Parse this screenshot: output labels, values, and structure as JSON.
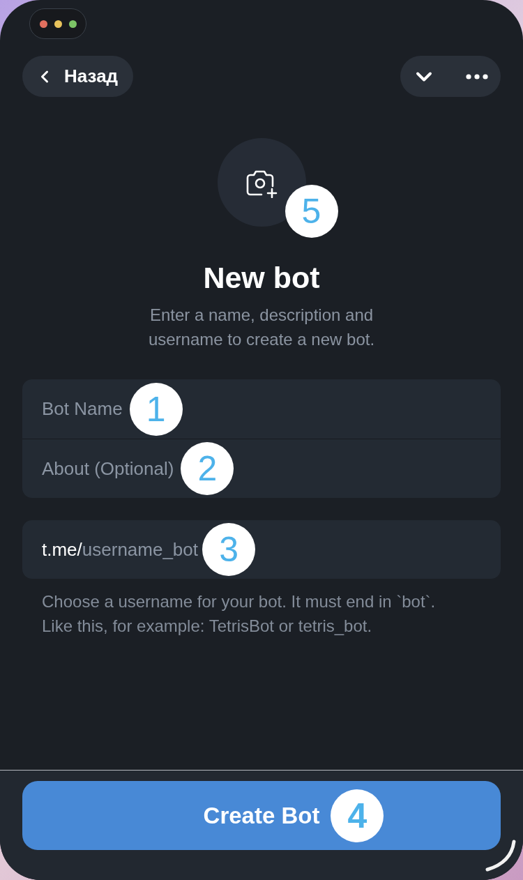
{
  "window_controls": [
    {
      "color": "#e2705f"
    },
    {
      "color": "#e8c35c"
    },
    {
      "color": "#7cc466"
    }
  ],
  "header": {
    "back_button": {
      "label": "Назад"
    }
  },
  "photo": {
    "marker": "5"
  },
  "title": "New bot",
  "subtitle": "Enter a name, description and username to create a new bot.",
  "fields": [
    {
      "placeholder": "Bot Name",
      "marker": "1"
    },
    {
      "placeholder": "About (Optional)",
      "marker": "2"
    }
  ],
  "username_field": {
    "prefix": "t.me/",
    "placeholder": "username_bot",
    "marker": "3"
  },
  "hint": "Choose a username for your bot. It must end in `bot`. Like this, for example: TetrisBot or tetris_bot.",
  "create_button": {
    "label": "Create Bot",
    "marker": "4"
  }
}
